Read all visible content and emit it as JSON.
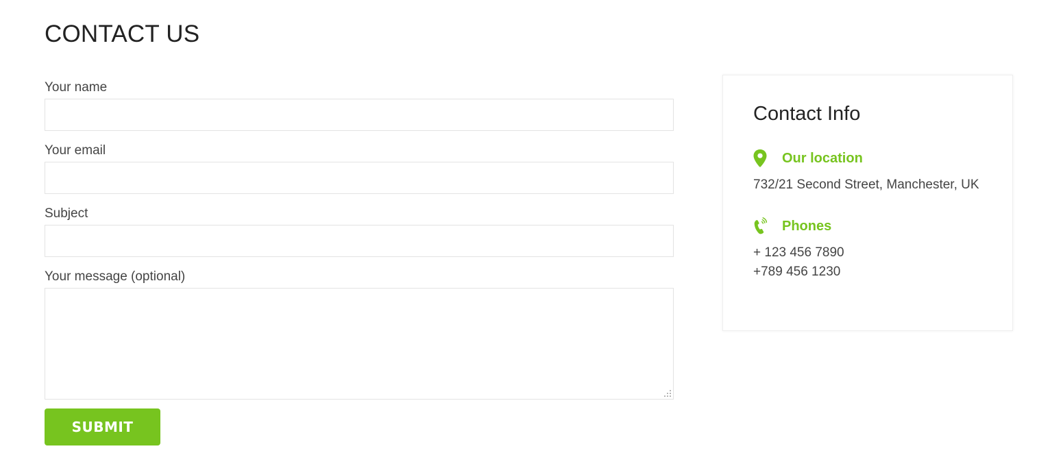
{
  "page": {
    "title": "CONTACT US"
  },
  "form": {
    "name_label": "Your name",
    "email_label": "Your email",
    "subject_label": "Subject",
    "message_label": "Your message (optional)",
    "name_value": "",
    "email_value": "",
    "subject_value": "",
    "message_value": "",
    "submit_label": "SUBMIT"
  },
  "contact_info": {
    "title": "Contact Info",
    "location": {
      "icon": "map-pin-icon",
      "label": "Our location",
      "address": "732/21 Second Street, Manchester, UK"
    },
    "phones": {
      "icon": "phone-ringing-icon",
      "label": "Phones",
      "numbers": [
        "+ 123 456 7890",
        "+789 456 1230"
      ]
    }
  },
  "colors": {
    "accent": "#77c41f",
    "text": "#444444",
    "heading": "#222222",
    "border": "#e3e3e3"
  }
}
